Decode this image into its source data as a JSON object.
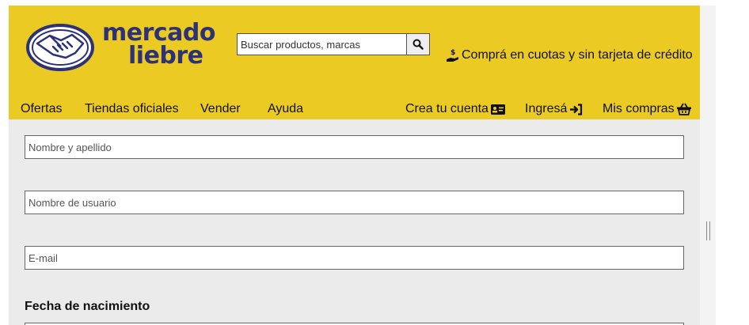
{
  "header": {
    "logo": {
      "line1": "mercado",
      "line2": "liebre"
    },
    "search": {
      "placeholder": "Buscar productos, marcas"
    },
    "promo": "Comprá en cuotas y sin tarjeta de crédito",
    "nav": {
      "left": [
        "Ofertas",
        "Tiendas oficiales",
        "Vender",
        "Ayuda"
      ],
      "create_account": "Crea tu cuenta",
      "login": "Ingresá",
      "purchases": "Mis compras"
    }
  },
  "form": {
    "full_name_placeholder": "Nombre y apellido",
    "username_placeholder": "Nombre de usuario",
    "email_placeholder": "E-mail",
    "birthdate_title": "Fecha de nacimiento"
  },
  "colors": {
    "brand_yellow": "#ebca24",
    "brand_blue": "#2d3277",
    "background": "#ebebeb"
  },
  "icons": [
    "handshake-logo-icon",
    "search-icon",
    "money-hand-icon",
    "id-card-icon",
    "sign-in-icon",
    "basket-icon"
  ]
}
